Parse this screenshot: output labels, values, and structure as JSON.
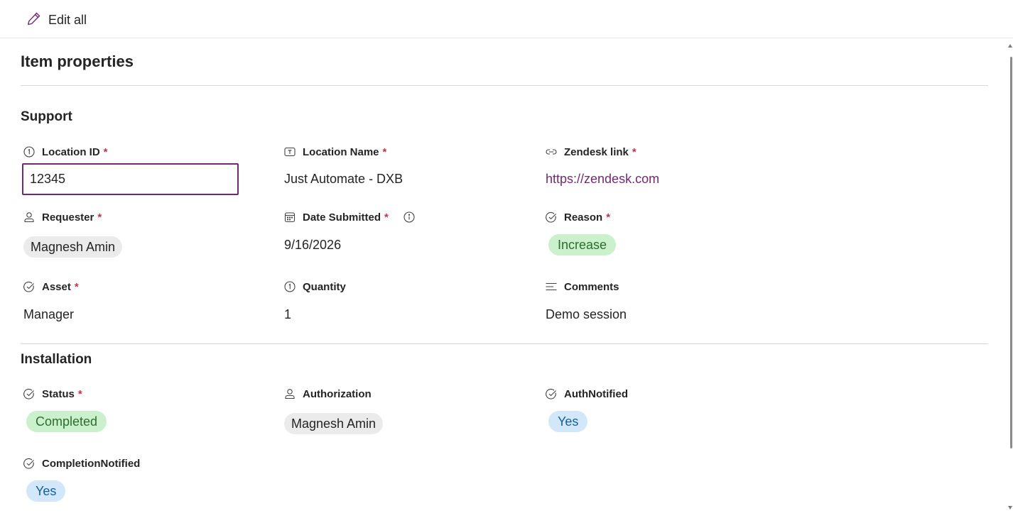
{
  "toolbar": {
    "edit_all_label": "Edit all"
  },
  "panel": {
    "title": "Item properties"
  },
  "sections": {
    "support": {
      "title": "Support",
      "location_id": {
        "label": "Location ID",
        "required": "*",
        "value": "12345"
      },
      "location_name": {
        "label": "Location Name",
        "required": "*",
        "value": "Just Automate - DXB"
      },
      "zendesk_link": {
        "label": "Zendesk link",
        "required": "*",
        "value": "https://zendesk.com"
      },
      "requester": {
        "label": "Requester",
        "required": "*",
        "value": "Magnesh Amin"
      },
      "date_submitted": {
        "label": "Date Submitted",
        "required": "*",
        "value": "9/16/2026"
      },
      "reason": {
        "label": "Reason",
        "required": "*",
        "value": "Increase"
      },
      "asset": {
        "label": "Asset",
        "required": "*",
        "value": "Manager"
      },
      "quantity": {
        "label": "Quantity",
        "value": "1"
      },
      "comments": {
        "label": "Comments",
        "value": "Demo session"
      }
    },
    "installation": {
      "title": "Installation",
      "status": {
        "label": "Status",
        "required": "*",
        "value": "Completed"
      },
      "authorization": {
        "label": "Authorization",
        "value": "Magnesh Amin"
      },
      "auth_notified": {
        "label": "AuthNotified",
        "value": "Yes"
      },
      "completion_notified": {
        "label": "CompletionNotified",
        "value": "Yes"
      }
    }
  },
  "colors": {
    "accent": "#742774",
    "required": "#c4314b",
    "chip_green_bg": "#caf0cc",
    "chip_blue_bg": "#d2e8fa",
    "chip_person_bg": "#ebebeb"
  },
  "icons": {
    "edit": "pencil-icon",
    "number": "number-icon",
    "text": "text-field-icon",
    "link": "link-icon",
    "person": "person-icon",
    "date": "calendar-icon",
    "info": "info-icon",
    "choice": "choice-check-icon",
    "multiline": "multiline-text-icon"
  }
}
